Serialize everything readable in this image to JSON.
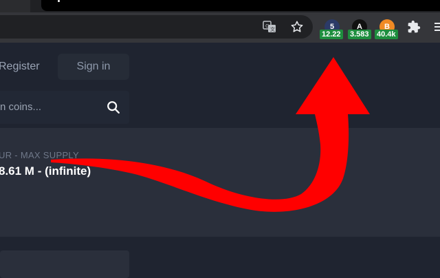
{
  "browser": {
    "extensions": [
      {
        "name": "extension-5",
        "glyph": "5",
        "badge": "12.22",
        "color": "#2b3a67"
      },
      {
        "name": "extension-a",
        "glyph": "A",
        "badge": "3.583",
        "color": "#111111"
      },
      {
        "name": "extension-b",
        "glyph": "B",
        "badge": "40.4k",
        "color": "#f08a24"
      }
    ],
    "badge_color": "#1e8e3e"
  },
  "nav": {
    "register_label": "Register",
    "signin_label": "Sign in"
  },
  "search": {
    "placeholder": "n coins..."
  },
  "coin": {
    "supply_label": "UR - MAX SUPPLY",
    "supply_value": "8.61 M - (infinite)"
  },
  "annotation": {
    "arrow_color": "#ff0000"
  }
}
